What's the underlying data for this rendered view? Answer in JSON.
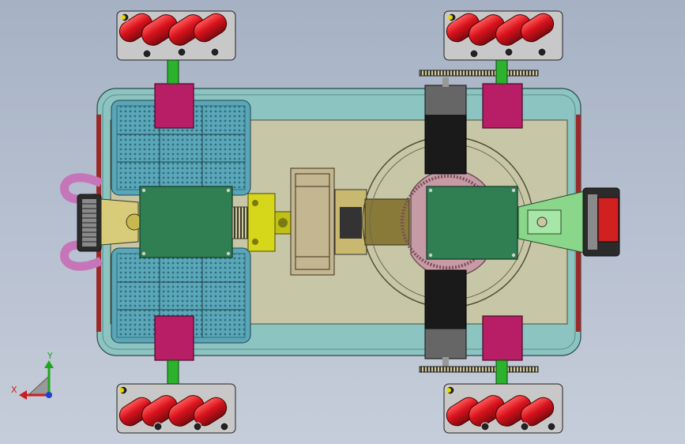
{
  "viewport": {
    "background_top": "#a6b2c4",
    "background_bottom": "#c6cdda"
  },
  "model": {
    "colors": {
      "chassis_fill": "#8cc4c2",
      "deck_fill": "#c7c6a6",
      "battery_fill": "#58a6b8",
      "controller_board": "#2f7f52",
      "motor_body": "#1a1a1a",
      "motor_flange": "#666666",
      "wheel_roller": "#d0101a",
      "wheel_hub": "#c8c8c8",
      "mount_block": "#b81e66",
      "axle": "#2db22d",
      "gear_ring": "#c69ba6",
      "bracket_yellow": "#d6d61a",
      "rear_bumper": "#c676b8"
    }
  },
  "triad": {
    "x_label": "X",
    "y_label": "Y",
    "x_color": "#cc1f1f",
    "y_color": "#1fa51f",
    "z_color": "#1f3fcc"
  }
}
